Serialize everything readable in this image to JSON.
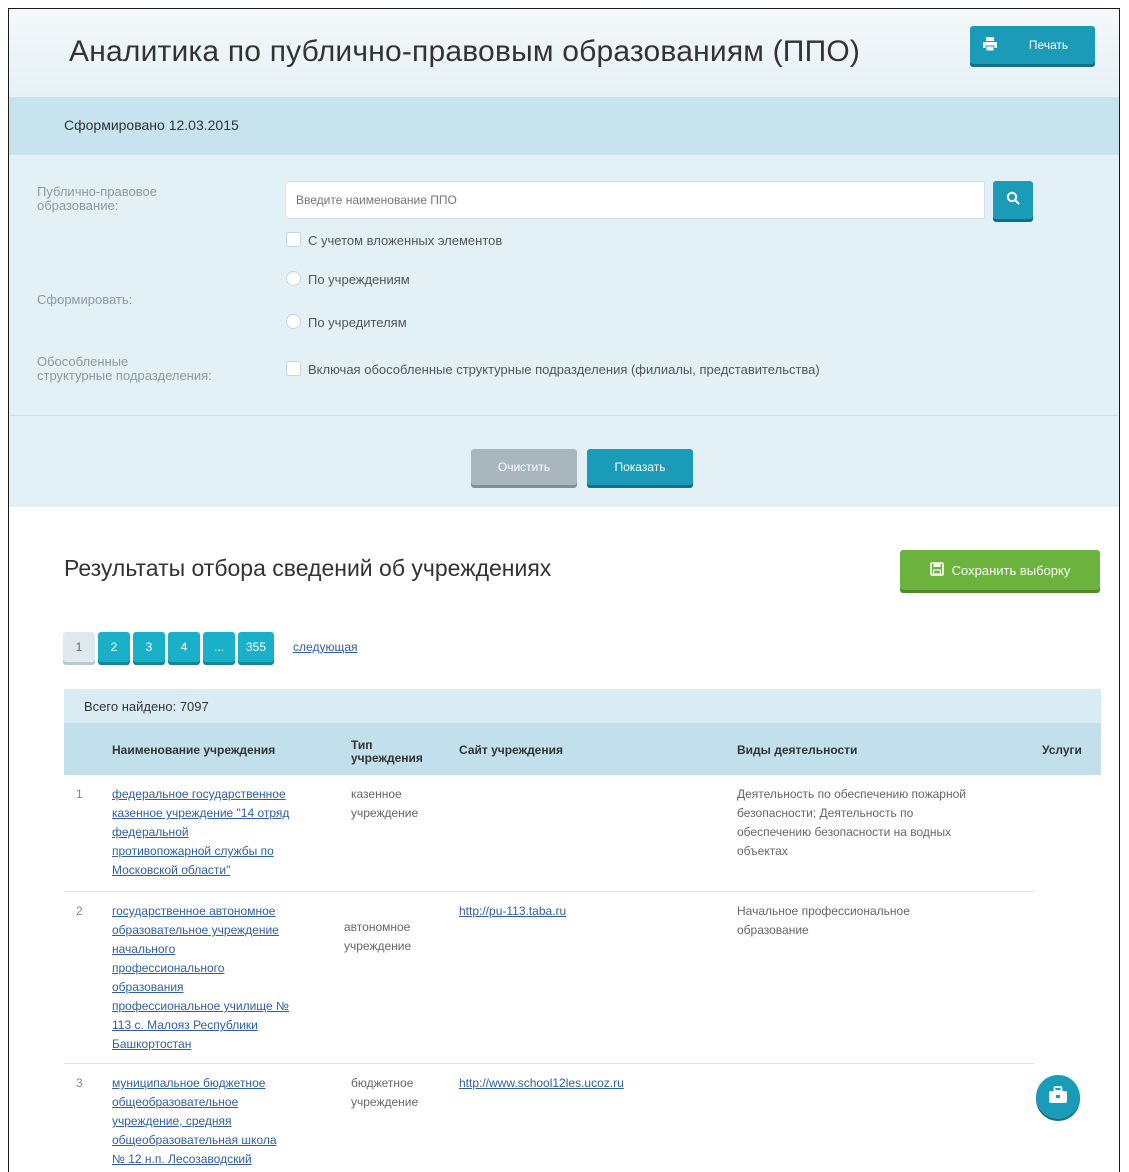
{
  "header": {
    "title": "Аналитика по публично-правовым образованиям (ППО)",
    "print_label": "Печать"
  },
  "generated": "Сформировано 12.03.2015",
  "filters": {
    "ppo_label_1": "Публично-правовое",
    "ppo_label_2": "образование:",
    "search_placeholder": "Введите наименование ППО",
    "search_value": "",
    "nested_label": "С учетом вложенных элементов",
    "form_label": "Сформировать:",
    "by_institutions": "По учреждениям",
    "by_founders": "По учредителям",
    "separate_label_1": "Обособленные",
    "separate_label_2": "структурные подразделения:",
    "separate_option": "Включая обособленные структурные подразделения (филиалы, представительства)",
    "clear_label": "Очистить",
    "show_label": "Показать"
  },
  "results": {
    "title": "Результаты отбора сведений об учреждениях",
    "save_label": "Сохранить выборку",
    "pages": [
      "1",
      "2",
      "3",
      "4",
      "...",
      "355"
    ],
    "active_page": "1",
    "next_label": "следующая",
    "total": "Всего найдено: 7097",
    "columns": {
      "name": "Наименование учреждения",
      "type_1": "Тип",
      "type_2": "учреждения",
      "site": "Сайт учреждения",
      "activities": "Виды деятельности",
      "services": "Услуги"
    },
    "rows": [
      {
        "num": "1",
        "name_lines": [
          "федеральное государственное",
          "казенное учреждение \"14 отряд",
          "федеральной",
          "противопожарной службы по",
          "Московской области\""
        ],
        "type_lines": [
          "казенное",
          "учреждение"
        ],
        "site": "",
        "activity_lines": [
          "Деятельность по обеспечению пожарной",
          "безопасности; Деятельность по",
          "обеспечению безопасности на водных",
          "объектах"
        ]
      },
      {
        "num": "2",
        "name_lines": [
          "государственное автономное",
          "образовательное учреждение",
          "начального",
          "профессионального",
          "образования",
          "профессиональное училище №",
          "113 с. Малояз Республики",
          "Башкортостан"
        ],
        "type_lines": [
          "автономное",
          "учреждение"
        ],
        "site": "http://pu-113.taba.ru",
        "activity_lines": [
          "Начальное профессиональное",
          "образование"
        ]
      },
      {
        "num": "3",
        "name_lines": [
          "муниципальное бюджетное",
          "общеобразовательное",
          "учреждение, средняя",
          "общеобразовательная школа",
          "№ 12 н.п. Лесозаводский"
        ],
        "type_lines": [
          "бюджетное",
          "учреждение"
        ],
        "site": "http://www.school12les.ucoz.ru",
        "activity_lines": []
      }
    ]
  },
  "colors": {
    "accent": "#1a9cb8",
    "save": "#6bb33d",
    "link": "#2f5fa0"
  },
  "icons": [
    "printer-icon",
    "search-icon",
    "save-icon",
    "briefcase-icon"
  ]
}
